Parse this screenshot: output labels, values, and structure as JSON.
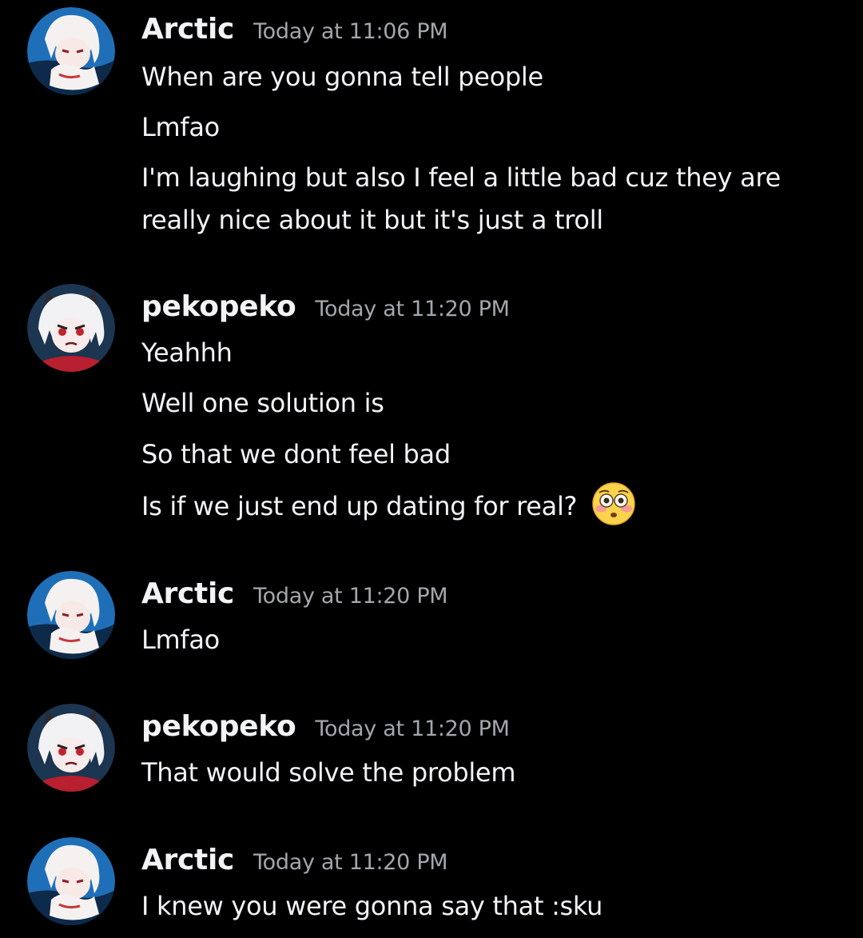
{
  "messages": [
    {
      "username": "Arctic",
      "timestamp": "Today at 11:06 PM",
      "lines": [
        "When are you gonna tell people",
        "Lmfao",
        "I'm laughing but also I feel a little bad cuz they are",
        "really nice about it but it's just a troll"
      ]
    },
    {
      "username": "pekopeko",
      "timestamp": "Today at 11:20 PM",
      "lines": [
        "Yeahhh",
        "Well one solution is",
        "So that we dont feel bad",
        "Is if we just end up dating for real?"
      ],
      "emoji": "flushed-face-emoji"
    },
    {
      "username": "Arctic",
      "timestamp": "Today at 11:20 PM",
      "lines": [
        "Lmfao"
      ]
    },
    {
      "username": "pekopeko",
      "timestamp": "Today at 11:20 PM",
      "lines": [
        "That would solve the problem"
      ]
    },
    {
      "username": "Arctic",
      "timestamp": "Today at 11:20 PM",
      "lines": [
        "I knew you were gonna say that :sku"
      ]
    }
  ],
  "colors": {
    "background": "#000000",
    "username": "#f2f3f5",
    "timestamp": "#a3a6ad",
    "text": "#f2f3f5"
  }
}
